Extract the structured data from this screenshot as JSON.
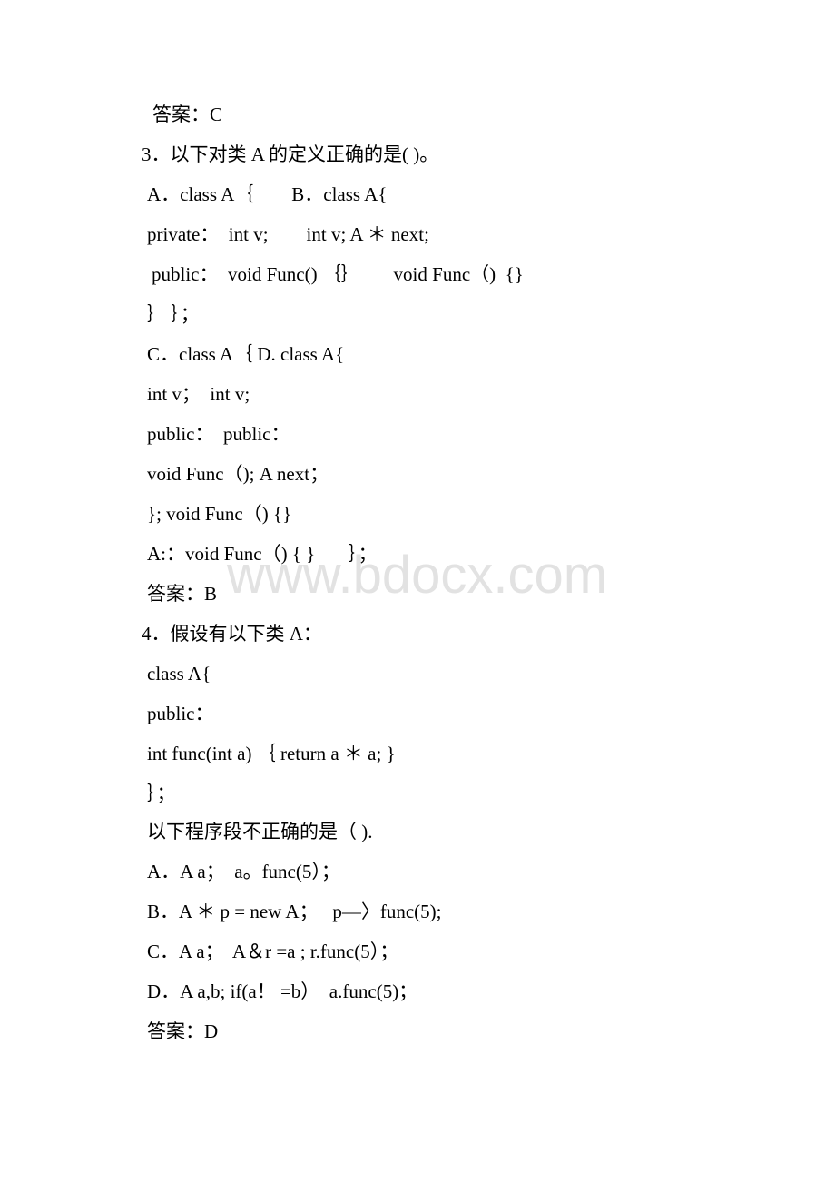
{
  "watermark": "www.bdocx.com",
  "lines": [
    "答案：C",
    "3．以下对类 A 的定义正确的是( )。",
    "A．class A｛        B．class A{",
    "private：  int v;        int v; A ＊ next;",
    "public：  void Func() ｛｝       void Func（)  {}",
    "｝ ｝；",
    "C．class A｛ D. class A{",
    "int v；  int v;",
    "public：  public：",
    "void Func（); A next；",
    "}; void Func（) {}",
    "A:：void Func（) { }       ｝；",
    "答案：B",
    "4．假设有以下类 A：",
    "class A{",
    "public：",
    "int func(int a) ｛ return a ＊ a; }",
    "｝；",
    "以下程序段不正确的是（ ).",
    "A．A a；  a。func(5）；",
    "B．A ＊ p = new A；   p—〉func(5);",
    "C．A a；  A＆r =a ; r.func(5）；",
    "D．A a,b; if(a！ =b）  a.func(5)；",
    "答案：D"
  ]
}
